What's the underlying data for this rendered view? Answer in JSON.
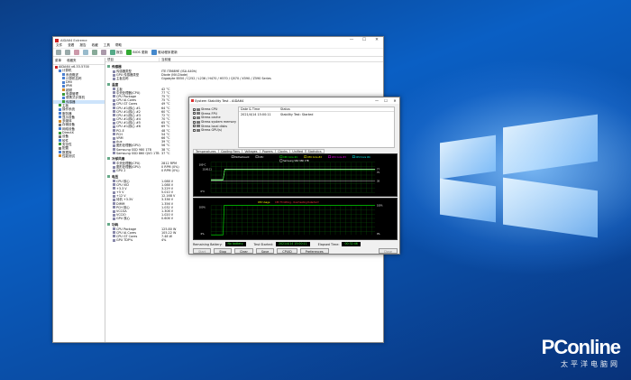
{
  "desktop": {
    "watermark_main": "PConline",
    "watermark_sub": "太平洋电脑网"
  },
  "main_window": {
    "title": "AIDA64 Extreme",
    "controls": [
      "—",
      "☐",
      "✕"
    ],
    "menu": [
      "文件",
      "查看",
      "报告",
      "收藏",
      "工具",
      "帮助"
    ],
    "toolbar": {
      "report": "报告",
      "bios": "BIOS 更新",
      "driver": "驱动程序更新"
    },
    "side_tabs": [
      "菜单",
      "收藏夹"
    ],
    "tree": [
      {
        "label": "AIDA64 v6.33.5700",
        "indent": 0,
        "color": "#c22"
      },
      {
        "label": "计算机",
        "indent": 1,
        "color": "#4a7fd0"
      },
      {
        "label": "系统概述",
        "indent": 2,
        "color": "#4a7fd0"
      },
      {
        "label": "计算机名称",
        "indent": 2,
        "color": "#4a7fd0"
      },
      {
        "label": "DMI",
        "indent": 2,
        "color": "#4a7fd0"
      },
      {
        "label": "IPMI",
        "indent": 2,
        "color": "#4a7fd0"
      },
      {
        "label": "超频",
        "indent": 2,
        "color": "#d08a2a"
      },
      {
        "label": "电源管理",
        "indent": 2,
        "color": "#3a9a3a"
      },
      {
        "label": "便携式计算机",
        "indent": 2,
        "color": "#4a7fd0"
      },
      {
        "label": "传感器",
        "indent": 2,
        "color": "#3a9a3a",
        "selected": true
      },
      {
        "label": "主板",
        "indent": 1,
        "color": "#3a9a3a"
      },
      {
        "label": "操作系统",
        "indent": 1,
        "color": "#4a7fd0"
      },
      {
        "label": "服务器",
        "indent": 1,
        "color": "#4a7fd0"
      },
      {
        "label": "显示设备",
        "indent": 1,
        "color": "#4a7fd0"
      },
      {
        "label": "多媒体",
        "indent": 1,
        "color": "#d08a2a"
      },
      {
        "label": "存储设备",
        "indent": 1,
        "color": "#777"
      },
      {
        "label": "网络设备",
        "indent": 1,
        "color": "#4a7fd0"
      },
      {
        "label": "DirectX",
        "indent": 1,
        "color": "#3a9a3a"
      },
      {
        "label": "设备",
        "indent": 1,
        "color": "#777"
      },
      {
        "label": "软件",
        "indent": 1,
        "color": "#4a7fd0"
      },
      {
        "label": "安全性",
        "indent": 1,
        "color": "#3a9a3a"
      },
      {
        "label": "配置",
        "indent": 1,
        "color": "#777"
      },
      {
        "label": "数据库",
        "indent": 1,
        "color": "#4a7fd0"
      },
      {
        "label": "性能测试",
        "indent": 1,
        "color": "#d08a2a"
      }
    ],
    "columns": [
      "项目",
      "当前值"
    ],
    "sections": [
      {
        "title": "传感器",
        "rows": [
          [
            "传感器类型",
            "ITE IT8689E (ISA A40h)"
          ],
          [
            "GPU 传感器类型",
            "Diode (NV-Diode)"
          ],
          [
            "主板名称",
            "Gigabyte B550 / C252 / L236 / H470 / H570 / Q570 / X590 / Z590 Series"
          ]
        ]
      },
      {
        "title": "温度",
        "rows": [
          [
            "主板",
            "42 °C"
          ],
          [
            "中央处理器(CPU)",
            "77 °C"
          ],
          [
            "CPU Package",
            "75 °C"
          ],
          [
            "CPU IA Cores",
            "75 °C"
          ],
          [
            "CPU GT Cores",
            "49 °C"
          ],
          [
            "CPU #1/核心 #1",
            "64 °C"
          ],
          [
            "CPU #1/核心 #2",
            "60 °C"
          ],
          [
            "CPU #1/核心 #3",
            "72 °C"
          ],
          [
            "CPU #1/核心 #4",
            "70 °C"
          ],
          [
            "CPU #1/核心 #5",
            "65 °C"
          ],
          [
            "CPU #1/核心 #6",
            "69 °C"
          ],
          [
            "PCI-E",
            "48 °C"
          ],
          [
            "PCH",
            "54 °C"
          ],
          [
            "VRM",
            "66 °C"
          ],
          [
            "Aux",
            "39 °C"
          ],
          [
            "图形处理器(GPU)",
            "56 °C"
          ],
          [
            "Samsung SSD 980 1TB",
            "38 °C"
          ],
          [
            "Samsung SSD 860 QVO 1TB",
            "37 °C"
          ]
        ]
      },
      {
        "title": "冷却风扇",
        "rows": [
          [
            "中央处理器(CPU)",
            "2812 RPM"
          ],
          [
            "图形处理器(GPU)",
            "0 RPM (0%)"
          ],
          [
            "GPU 2",
            "0 RPM (0%)"
          ]
        ]
      },
      {
        "title": "电压",
        "rows": [
          [
            "CPU 核心",
            "1.088 V"
          ],
          [
            "CPU VID",
            "1.088 V"
          ],
          [
            "+3.3 V",
            "3.229 V"
          ],
          [
            "+5 V",
            "5.010 V"
          ],
          [
            "+12 V",
            "12.168 V"
          ],
          [
            "待机 +3.3V",
            "3.336 V"
          ],
          [
            "DIMM",
            "1.356 V"
          ],
          [
            "PCH 核心",
            "1.032 V"
          ],
          [
            "VCCSA",
            "1.308 V"
          ],
          [
            "VCCIO",
            "1.020 V"
          ],
          [
            "GPU 核心",
            "0.606 V"
          ]
        ]
      },
      {
        "title": "功耗",
        "rows": [
          [
            "CPU Package",
            "125.80 W"
          ],
          [
            "CPU IA Cores",
            "105.22 W"
          ],
          [
            "CPU GT Cores",
            "7.48 W"
          ],
          [
            "GPU TDP%",
            "4%"
          ]
        ]
      }
    ]
  },
  "stability_window": {
    "title": "System Stability Test - AIDA64",
    "controls": [
      "—",
      "☐",
      "✕"
    ],
    "checks": [
      {
        "label": "Stress CPU",
        "checked": true
      },
      {
        "label": "Stress FPU",
        "checked": true
      },
      {
        "label": "Stress cache",
        "checked": true
      },
      {
        "label": "Stress system memory",
        "checked": true
      },
      {
        "label": "Stress local disks",
        "checked": false
      },
      {
        "label": "Stress GPU(s)",
        "checked": false
      }
    ],
    "status_headers": [
      "Date & Time",
      "Status"
    ],
    "status_rows": [
      [
        "2021/4/14 15:00:11",
        "Stability Test: Started"
      ]
    ],
    "tabs": [
      "Temperatures",
      "Cooling Fans",
      "Voltages",
      "Powers",
      "Clocks",
      "Unified",
      "Statistics"
    ],
    "graph1": {
      "legend": [
        "Motherboard",
        "CPU",
        "CPU Core #1",
        "CPU Core #2",
        "CPU Core #3",
        "CPU Core #4",
        "Samsung SSD 980 1TB"
      ],
      "legend_colors": [
        "#ffffff",
        "#ffffff",
        "#00ff00",
        "#ffff00",
        "#ff00ff",
        "#00ffff",
        "#ffffff"
      ],
      "ymax": "100°C",
      "ymin": "0°C",
      "right_values": [
        "77",
        "75",
        "38"
      ],
      "time_label": "15:00:11"
    },
    "graph2": {
      "title_a": "CPU Usage",
      "title_b": "CPU Throttling - Overheating Detected!",
      "ymax": "100%",
      "ymin": "0%",
      "right_top": "100%",
      "right_bottom": "0%"
    },
    "remaining_battery_label": "Remaining Battery:",
    "remaining_battery_value": "No battery",
    "test_started_label": "Test Started:",
    "test_started_value": "2021/4/14 15:00:11",
    "elapsed_label": "Elapsed Time:",
    "elapsed_value": "00:32:46",
    "buttons": [
      "Start",
      "Stop",
      "Clear",
      "Save",
      "CPUID",
      "Preferences",
      "Close"
    ]
  }
}
